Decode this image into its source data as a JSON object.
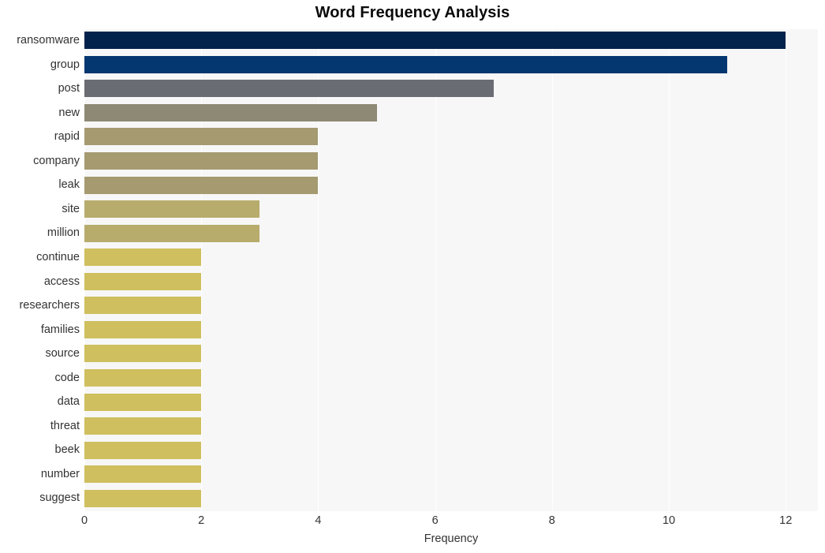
{
  "chart_data": {
    "type": "bar",
    "orientation": "horizontal",
    "title": "Word Frequency Analysis",
    "xlabel": "Frequency",
    "ylabel": "",
    "xlim": [
      0,
      12.55
    ],
    "xticks": [
      0,
      2,
      4,
      6,
      8,
      10,
      12
    ],
    "xtick_labels": [
      "0",
      "2",
      "4",
      "6",
      "8",
      "10",
      "12"
    ],
    "grid": true,
    "grid_axis": "x",
    "legend": false,
    "plot_background": "#f7f7f7",
    "figure_background": "#ffffff",
    "categories": [
      "ransomware",
      "group",
      "post",
      "new",
      "rapid",
      "company",
      "leak",
      "site",
      "million",
      "continue",
      "access",
      "researchers",
      "families",
      "source",
      "code",
      "data",
      "threat",
      "beek",
      "number",
      "suggest"
    ],
    "values": [
      12,
      11,
      7,
      5,
      4,
      4,
      4,
      3,
      3,
      2,
      2,
      2,
      2,
      2,
      2,
      2,
      2,
      2,
      2,
      2
    ],
    "bar_colors": [
      "#04234c",
      "#04366f",
      "#6a6c74",
      "#8e8975",
      "#a59a70",
      "#a59a70",
      "#a59a70",
      "#b7ac6c",
      "#b7ac6c",
      "#cfbf5e",
      "#cfbf5e",
      "#cfbf5e",
      "#cfbf5e",
      "#cfbf5e",
      "#cfbf5e",
      "#cfbf5e",
      "#cfbf5e",
      "#cfbf5e",
      "#cfbf5e",
      "#cfbf5e"
    ]
  }
}
